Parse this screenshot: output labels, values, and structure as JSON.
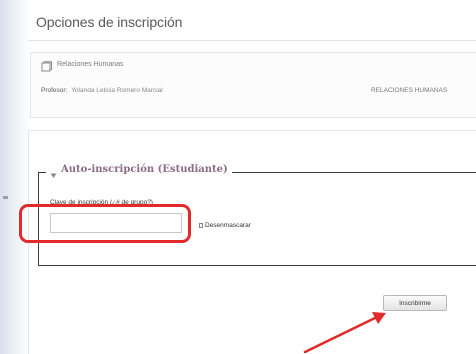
{
  "page": {
    "title": "Opciones de inscripción"
  },
  "course": {
    "icon": "course-icon",
    "name": "Relaciones Humanas",
    "teacher_label": "Profesor:",
    "teacher_name": "Yolanda Leticia Romero Marcial",
    "category": "RELACIONES HUMANAS"
  },
  "enrolment": {
    "legend_icon": "triangle-down-icon",
    "legend": "Auto-inscripción (Estudiante)",
    "key_label": "Clave de inscripción (¿# de grupo?)",
    "key_value": "",
    "unmask_label": "Desenmascarar",
    "button_label": "Inscribirme"
  },
  "colors": {
    "highlight": "#e12a2a",
    "legend_text": "#8a6a86"
  }
}
